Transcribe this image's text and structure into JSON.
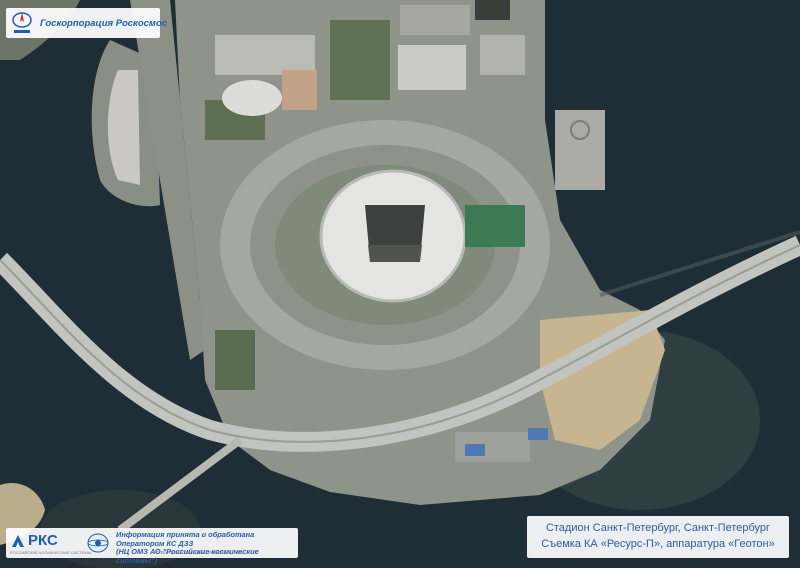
{
  "logo": {
    "text": "Госкорпорация Роскосмос",
    "icon": "roscosmos-emblem",
    "color": "#1f5fae"
  },
  "caption": {
    "line1": "Стадион Санкт-Петербург, Санкт-Петербург",
    "line2": "Съемка КА «Ресурс-П», аппаратура «Геотон»",
    "color": "#2b5ea8"
  },
  "credit": {
    "rks_label": "РКС",
    "rks_sub": "РОССИЙСКИЕ КОСМИЧЕСКИЕ СИСТЕМЫ",
    "line1": "Информация принята и обработана Оператором КС ДЗЗ",
    "line2": "(НЦ ОМЗ АО \"Российские космические системы\")",
    "rights": "© Все права защищены, Роскосмос, 2018"
  },
  "colors": {
    "water": "#1f2d36",
    "land": "#8e948a",
    "roof": "#e3e3e1",
    "field": "#3c7a55",
    "sand": "#c7b491"
  }
}
